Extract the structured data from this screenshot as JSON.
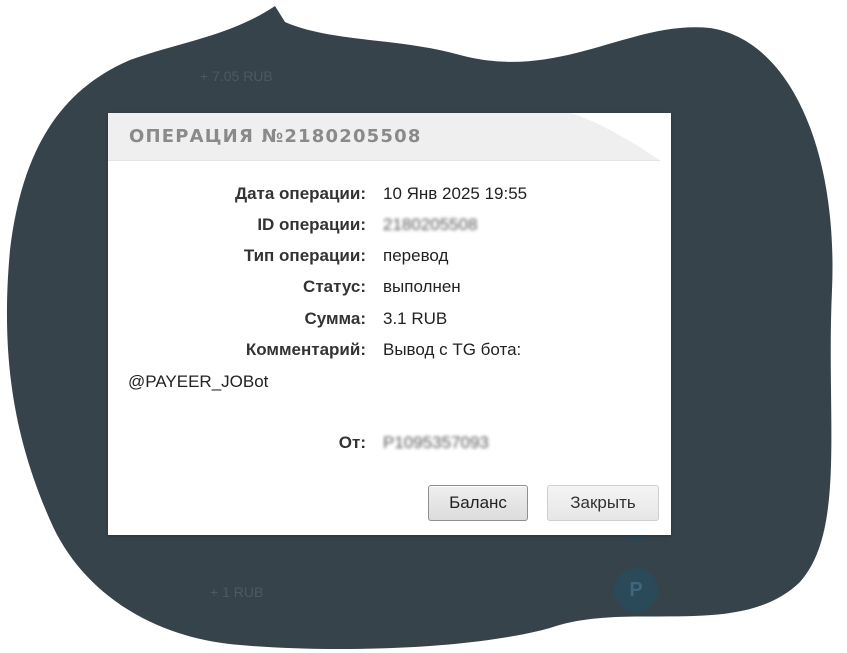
{
  "background": {
    "amount_top": "+ 7.05 RUB",
    "amount_bottom": "+ 1 RUB",
    "avatar_letter": "P",
    "blob_color": "#36434b"
  },
  "modal": {
    "title": "ОПЕРАЦИЯ №2180205508",
    "rows": [
      {
        "label": "Дата операции:",
        "value": "10 Янв 2025 19:55"
      },
      {
        "label": "ID операции:",
        "value": "2180205508"
      },
      {
        "label": "Тип операции:",
        "value": "перевод"
      },
      {
        "label": "Статус:",
        "value": "выполнен"
      },
      {
        "label": "Сумма:",
        "value": "3.1 RUB"
      },
      {
        "label": "Комментарий:",
        "value": "Вывод с TG бота:"
      }
    ],
    "comment_continuation": "@PAYEER_JOBot",
    "from": {
      "label": "От:",
      "value": "P1095357093"
    },
    "buttons": {
      "balance": "Баланс",
      "close": "Закрыть"
    }
  }
}
